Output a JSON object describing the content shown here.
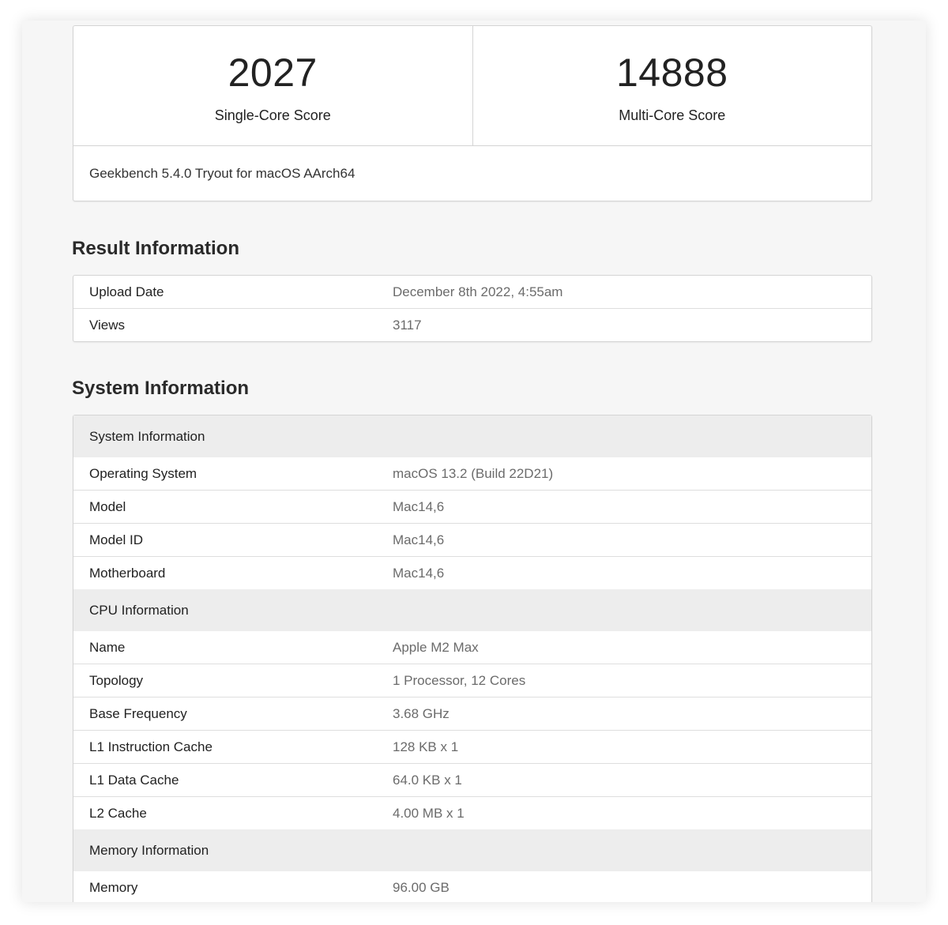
{
  "scores": {
    "single_core": {
      "value": "2027",
      "label": "Single-Core Score"
    },
    "multi_core": {
      "value": "14888",
      "label": "Multi-Core Score"
    },
    "version": "Geekbench 5.4.0 Tryout for macOS AArch64"
  },
  "result_information": {
    "title": "Result Information",
    "rows": [
      {
        "key": "Upload Date",
        "value": "December 8th 2022, 4:55am"
      },
      {
        "key": "Views",
        "value": "3117"
      }
    ]
  },
  "system_information": {
    "title": "System Information",
    "groups": [
      {
        "header": "System Information",
        "rows": [
          {
            "key": "Operating System",
            "value": "macOS 13.2 (Build 22D21)"
          },
          {
            "key": "Model",
            "value": "Mac14,6"
          },
          {
            "key": "Model ID",
            "value": "Mac14,6"
          },
          {
            "key": "Motherboard",
            "value": "Mac14,6"
          }
        ]
      },
      {
        "header": "CPU Information",
        "rows": [
          {
            "key": "Name",
            "value": "Apple M2 Max"
          },
          {
            "key": "Topology",
            "value": "1 Processor, 12 Cores"
          },
          {
            "key": "Base Frequency",
            "value": "3.68 GHz"
          },
          {
            "key": "L1 Instruction Cache",
            "value": "128 KB x 1"
          },
          {
            "key": "L1 Data Cache",
            "value": "64.0 KB x 1"
          },
          {
            "key": "L2 Cache",
            "value": "4.00 MB x 1"
          }
        ]
      },
      {
        "header": "Memory Information",
        "rows": [
          {
            "key": "Memory",
            "value": "96.00 GB"
          }
        ]
      }
    ]
  }
}
